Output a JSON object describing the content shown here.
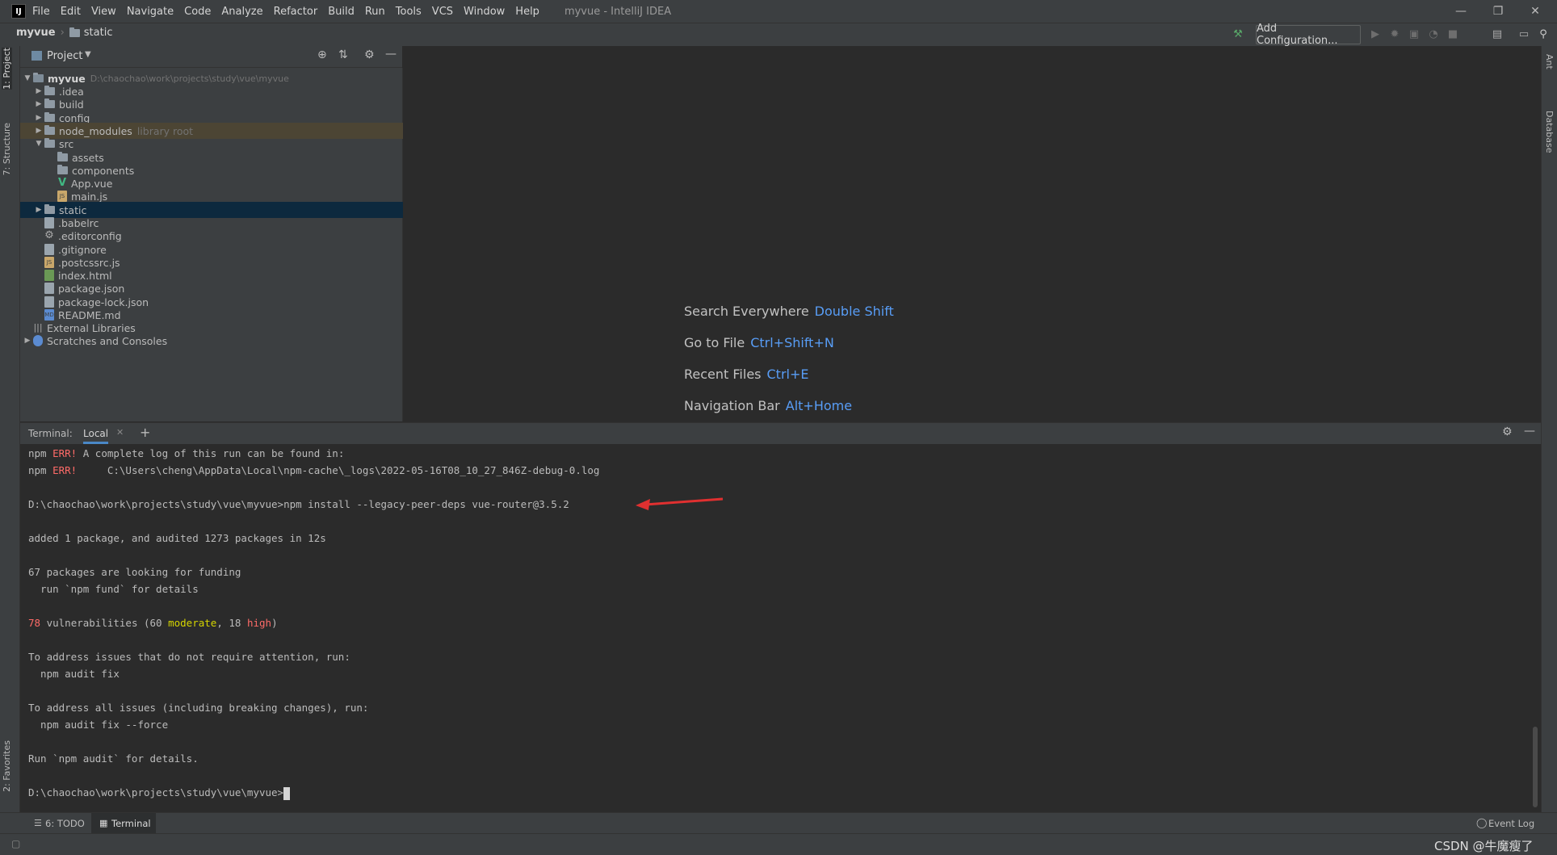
{
  "app": {
    "title": "myvue - IntelliJ IDEA",
    "logo": "IJ",
    "menu": [
      "File",
      "Edit",
      "View",
      "Navigate",
      "Code",
      "Analyze",
      "Refactor",
      "Build",
      "Run",
      "Tools",
      "VCS",
      "Window",
      "Help"
    ]
  },
  "breadcrumb": {
    "project": "myvue",
    "folder": "static"
  },
  "toolbar": {
    "add_configuration": "Add Configuration..."
  },
  "left_tabs": {
    "project": "1: Project",
    "structure": "7: Structure",
    "favorites": "2: Favorites"
  },
  "right_tabs": {
    "ant": "Ant",
    "database": "Database"
  },
  "project_panel": {
    "title": "Project",
    "root": {
      "name": "myvue",
      "path": "D:\\chaochao\\work\\projects\\study\\vue\\myvue"
    },
    "items": [
      {
        "label": ".idea",
        "hint": ""
      },
      {
        "label": "build",
        "hint": ""
      },
      {
        "label": "config",
        "hint": ""
      },
      {
        "label": "node_modules",
        "hint": "library root"
      },
      {
        "label": "src",
        "hint": ""
      },
      {
        "label": "assets",
        "hint": ""
      },
      {
        "label": "components",
        "hint": ""
      },
      {
        "label": "App.vue",
        "hint": ""
      },
      {
        "label": "main.js",
        "hint": ""
      },
      {
        "label": "static",
        "hint": ""
      },
      {
        "label": ".babelrc",
        "hint": ""
      },
      {
        "label": ".editorconfig",
        "hint": ""
      },
      {
        "label": ".gitignore",
        "hint": ""
      },
      {
        "label": ".postcssrc.js",
        "hint": ""
      },
      {
        "label": "index.html",
        "hint": ""
      },
      {
        "label": "package.json",
        "hint": ""
      },
      {
        "label": "package-lock.json",
        "hint": ""
      },
      {
        "label": "README.md",
        "hint": ""
      },
      {
        "label": "External Libraries",
        "hint": ""
      },
      {
        "label": "Scratches and Consoles",
        "hint": ""
      }
    ]
  },
  "editor_tips": [
    {
      "label": "Search Everywhere",
      "key": "Double Shift"
    },
    {
      "label": "Go to File",
      "key": "Ctrl+Shift+N"
    },
    {
      "label": "Recent Files",
      "key": "Ctrl+E"
    },
    {
      "label": "Navigation Bar",
      "key": "Alt+Home"
    }
  ],
  "terminal": {
    "label": "Terminal:",
    "tab": "Local",
    "lines": {
      "l1a": "npm ",
      "l1b": "ERR!",
      "l1c": " A complete log of this run can be found in:",
      "l2a": "npm ",
      "l2b": "ERR!",
      "l2c": "     C:\\Users\\cheng\\AppData\\Local\\npm-cache\\_logs\\2022-05-16T08_10_27_846Z-debug-0.log",
      "l3": "D:\\chaochao\\work\\projects\\study\\vue\\myvue>npm install --legacy-peer-deps vue-router@3.5.2",
      "l4": "added 1 package, and audited 1273 packages in 12s",
      "l5": "67 packages are looking for funding",
      "l6": "  run `npm fund` for details",
      "l7a": "78",
      "l7b": " vulnerabilities (60 ",
      "l7c": "moderate",
      "l7d": ", 18 ",
      "l7e": "high",
      "l7f": ")",
      "l8": "To address issues that do not require attention, run:",
      "l9": "  npm audit fix",
      "l10": "To address all issues (including breaking changes), run:",
      "l11": "  npm audit fix --force",
      "l12": "Run `npm audit` for details.",
      "l13": "D:\\chaochao\\work\\projects\\study\\vue\\myvue>"
    }
  },
  "bottom_tabs": {
    "todo": "6: TODO",
    "terminal": "Terminal"
  },
  "status": {
    "event_log": "Event Log",
    "watermark": "CSDN @牛魔瘦了"
  },
  "colors": {
    "error": "#ff6b68",
    "moderate": "#d5d500",
    "shortcut": "#589df6",
    "annotation_arrow": "#e03030"
  }
}
